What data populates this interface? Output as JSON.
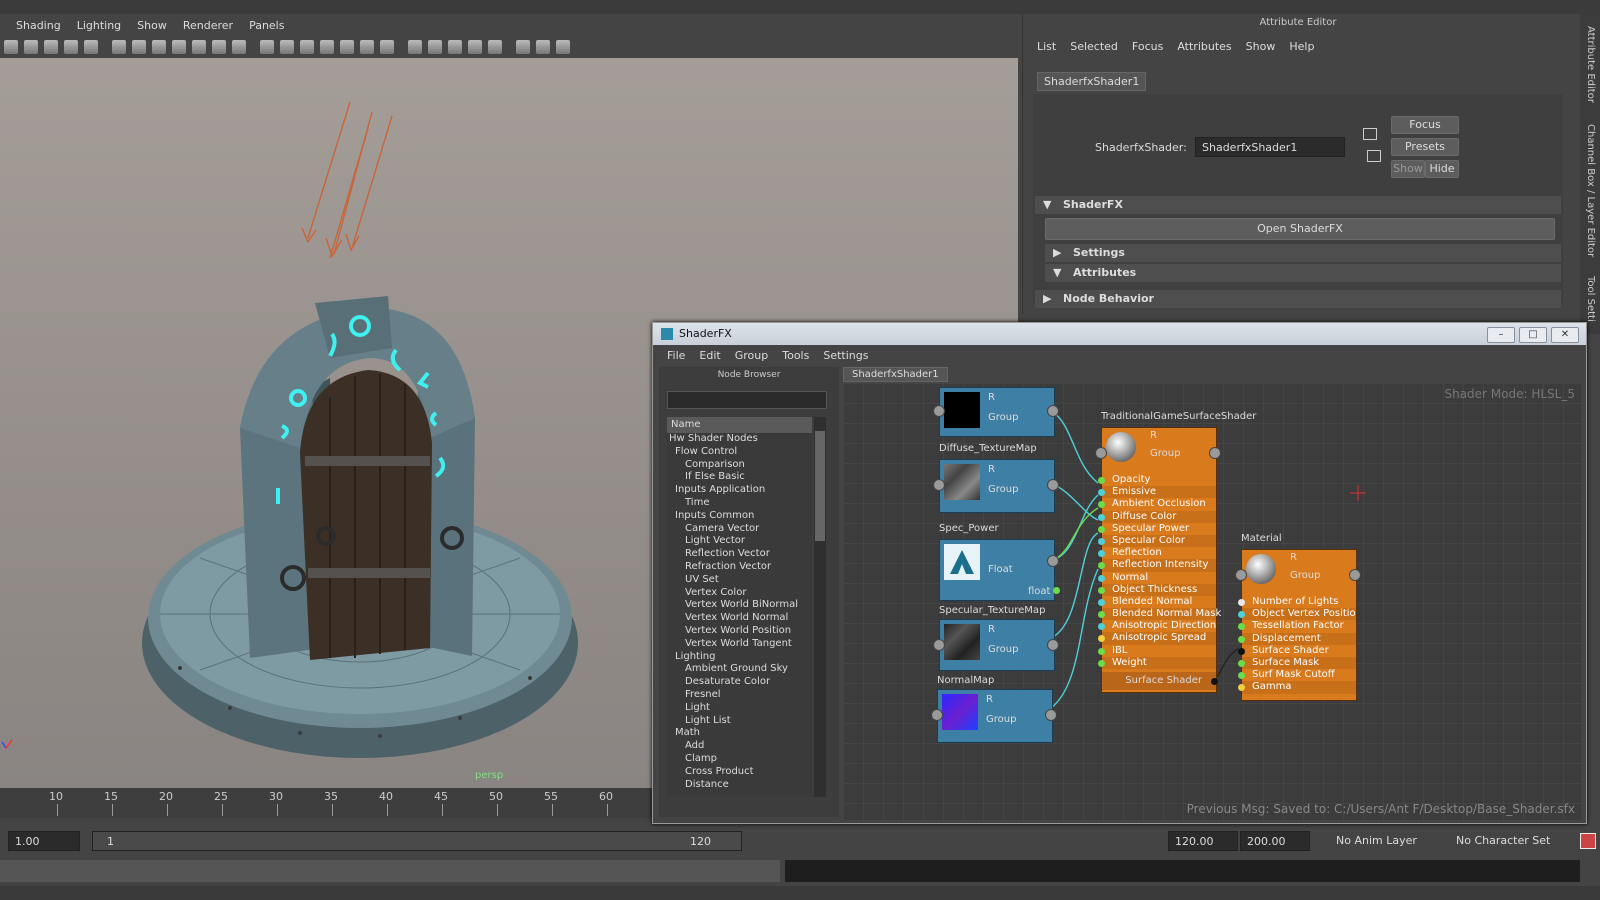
{
  "menubar": [
    "Shading",
    "Lighting",
    "Show",
    "Renderer",
    "Panels"
  ],
  "viewport": {
    "camera_label": "persp"
  },
  "timeline": {
    "ticks": [
      "10",
      "15",
      "20",
      "25",
      "30",
      "35",
      "40",
      "45",
      "50",
      "55",
      "60"
    ]
  },
  "range": {
    "current_frame": "1.00",
    "start": "1",
    "end": "120",
    "range_end": "120.00",
    "anim_end": "200.00",
    "anim_layer": "No Anim Layer",
    "character_set": "No Character Set"
  },
  "attribute_editor": {
    "title": "Attribute Editor",
    "menu": [
      "List",
      "Selected",
      "Focus",
      "Attributes",
      "Show",
      "Help"
    ],
    "tab": "ShaderfxShader1",
    "node_type_label": "ShaderfxShader:",
    "node_name": "ShaderfxShader1",
    "buttons": {
      "focus": "Focus",
      "presets": "Presets",
      "show": "Show",
      "hide": "Hide"
    },
    "sections": {
      "shaderfx": "ShaderFX",
      "open": "Open ShaderFX",
      "settings": "Settings",
      "attributes": "Attributes",
      "node_behavior": "Node Behavior"
    },
    "side_tabs": [
      "Attribute Editor",
      "Channel Box / Layer Editor",
      "Tool Setti"
    ]
  },
  "shaderfx": {
    "title": "ShaderFX",
    "menu": [
      "File",
      "Edit",
      "Group",
      "Tools",
      "Settings"
    ],
    "node_browser": {
      "title": "Node Browser",
      "header": "Name",
      "items": [
        "Hw Shader Nodes",
        "Flow Control",
        "Comparison",
        "If Else Basic",
        "Inputs Application",
        "Time",
        "Inputs Common",
        "Camera Vector",
        "Light Vector",
        "Reflection Vector",
        "Refraction Vector",
        "UV Set",
        "Vertex Color",
        "Vertex World BiNormal",
        "Vertex World Normal",
        "Vertex World Position",
        "Vertex World Tangent",
        "Lighting",
        "Ambient Ground Sky",
        "Desaturate Color",
        "Fresnel",
        "Light",
        "Light List",
        "Math",
        "Add",
        "Clamp",
        "Cross Product",
        "Distance"
      ]
    },
    "graph_tab": "ShaderfxShader1",
    "shader_mode": "Shader Mode: HLSL_5",
    "previous_msg": "Previous Msg: Saved to: C:/Users/Ant F/Desktop/Base_Shader.sfx",
    "nodes": {
      "top": {
        "channel": "R",
        "type": "Group"
      },
      "diffuse": {
        "name": "Diffuse_TextureMap",
        "channel": "R",
        "type": "Group"
      },
      "spec_power": {
        "name": "Spec_Power",
        "type": "Float",
        "out": "float"
      },
      "specular": {
        "name": "Specular_TextureMap",
        "channel": "R",
        "type": "Group"
      },
      "normal": {
        "name": "NormalMap",
        "channel": "R",
        "type": "Group"
      },
      "tgss": {
        "name": "TraditionalGameSurfaceShader",
        "channel": "R",
        "type": "Group",
        "ports": [
          "Opacity",
          "Emissive",
          "Ambient Occlusion",
          "Diffuse Color",
          "Specular Power",
          "Specular Color",
          "Reflection",
          "Reflection Intensity",
          "Normal",
          "Object Thickness",
          "Blended Normal",
          "Blended Normal Mask",
          "Anisotropic Direction",
          "Anisotropic Spread",
          "IBL",
          "Weight"
        ],
        "output": "Surface Shader"
      },
      "material": {
        "name": "Material",
        "channel": "R",
        "type": "Group",
        "ports": [
          "Number of Lights",
          "Object Vertex Positio",
          "Tessellation Factor",
          "Displacement",
          "Surface Shader",
          "Surface Mask",
          "Surf Mask Cutoff",
          "Gamma"
        ]
      }
    }
  },
  "colors": {
    "node_blue": "#3d7fa5",
    "node_orange": "#d97a1c",
    "wire": "#4fd0d8",
    "rune": "#3ff0f0"
  }
}
